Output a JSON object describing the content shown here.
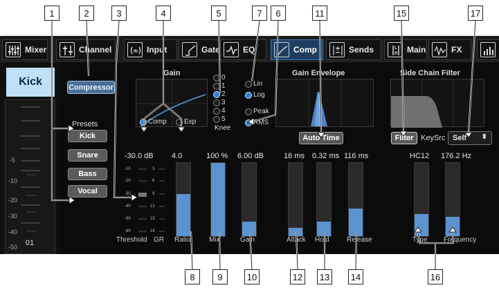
{
  "callouts": [
    "1",
    "2",
    "3",
    "4",
    "5",
    "6",
    "7",
    "11",
    "15",
    "17",
    "8",
    "9",
    "10",
    "12",
    "13",
    "14",
    "16"
  ],
  "tabs": [
    {
      "label": "Mixer",
      "icon": "mixer-grid-icon"
    },
    {
      "label": "Channel",
      "icon": "channel-icon"
    },
    {
      "label": "Input",
      "icon": "input-icon"
    },
    {
      "label": "Gate",
      "icon": "gate-curve-icon"
    },
    {
      "label": "EQ",
      "icon": "eq-curve-icon"
    },
    {
      "label": "Comp",
      "icon": "comp-curve-icon"
    },
    {
      "label": "Sends",
      "icon": "sends-icon"
    },
    {
      "label": "Main",
      "icon": "main-lr-icon"
    },
    {
      "label": "FX",
      "icon": "fx-wave-icon"
    },
    {
      "label": "",
      "icon": "meters-icon"
    }
  ],
  "channel": {
    "name": "Kick",
    "number": "01",
    "meter_ticks": [
      "-5",
      "-10",
      "-20",
      "-30",
      "-40",
      "-50"
    ]
  },
  "comp": {
    "compressor_button": "Compressor",
    "presets_label": "Presets",
    "presets": [
      "Kick",
      "Snare",
      "Bass",
      "Vocal"
    ],
    "gain_title": "Gain",
    "knee_options": [
      "0",
      "1",
      "2",
      "3",
      "4",
      "5"
    ],
    "knee_selected": "2",
    "knee_label": "Knee",
    "mode_options": [
      "Comp",
      "Exp"
    ],
    "mode_selected": "Comp",
    "scale_options": [
      "Lin",
      "Log"
    ],
    "scale_selected": "Log",
    "detect_options": [
      "Peak",
      "RMS"
    ],
    "detect_selected": "RMS",
    "envelope_title": "Gain Envelope",
    "auto_time_button": "Auto Time",
    "sidechain_title": "Side Chain Filter",
    "filter_button": "Filter",
    "keysrc_label": "KeySrc",
    "keysrc_value": "Self"
  },
  "threshold": {
    "value": "-30.0 dB",
    "label": "Threshold",
    "gr_label": "GR",
    "threshold_scale": [
      "-10",
      "-20",
      "-30",
      "-40",
      "-50",
      "-60"
    ],
    "gr_scale": [
      "3",
      "6",
      "9",
      "12",
      "15",
      "18"
    ]
  },
  "faders": [
    {
      "id": "ratio",
      "label": "Ratio",
      "value": "4.0",
      "level": 0.58
    },
    {
      "id": "mix",
      "label": "Mix",
      "value": "100 %",
      "level": 1.0
    },
    {
      "id": "gain",
      "label": "Gain",
      "value": "6.00 dB",
      "level": 0.2
    },
    {
      "id": "attack",
      "label": "Attack",
      "value": "16 ms",
      "level": 0.11
    },
    {
      "id": "hold",
      "label": "Hold",
      "value": "0.32 ms",
      "level": 0.2
    },
    {
      "id": "release",
      "label": "Release",
      "value": "116 ms",
      "level": 0.38
    },
    {
      "id": "type",
      "label": "Type",
      "value": "HC12",
      "level": 0.3
    },
    {
      "id": "frequency",
      "label": "Frequency",
      "value": "176.2 Hz",
      "level": 0.26
    }
  ],
  "colors": {
    "accent": "#2f7fd8",
    "fader_fill": "#5b93d0",
    "active_tab": "#1e3d5f",
    "channel_name_bg": "#bfe0f6"
  }
}
